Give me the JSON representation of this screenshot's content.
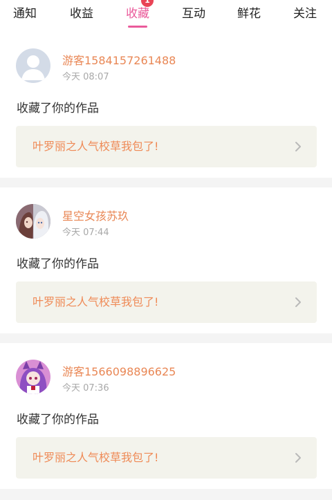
{
  "tabs": [
    {
      "label": "通知"
    },
    {
      "label": "收益"
    },
    {
      "label": "收藏",
      "badge": "1",
      "active": true
    },
    {
      "label": "互动"
    },
    {
      "label": "鲜花"
    },
    {
      "label": "关注"
    }
  ],
  "colors": {
    "accent": "#ea5a9a",
    "badge": "#e94456",
    "username": "#e98755",
    "work_title": "#ef8a56"
  },
  "items": [
    {
      "username": "游客1584157261488",
      "time": "今天 08:07",
      "action": "收藏了你的作品",
      "work_title": "叶罗丽之人气校草我包了!",
      "avatar_icon": "default-user-avatar"
    },
    {
      "username": "星空女孩苏玖",
      "time": "今天 07:44",
      "action": "收藏了你的作品",
      "work_title": "叶罗丽之人气校草我包了!",
      "avatar_icon": "anime-girls-avatar"
    },
    {
      "username": "游客1566098896625",
      "time": "今天 07:36",
      "action": "收藏了你的作品",
      "work_title": "叶罗丽之人气校草我包了!",
      "avatar_icon": "anime-catgirl-avatar"
    }
  ]
}
